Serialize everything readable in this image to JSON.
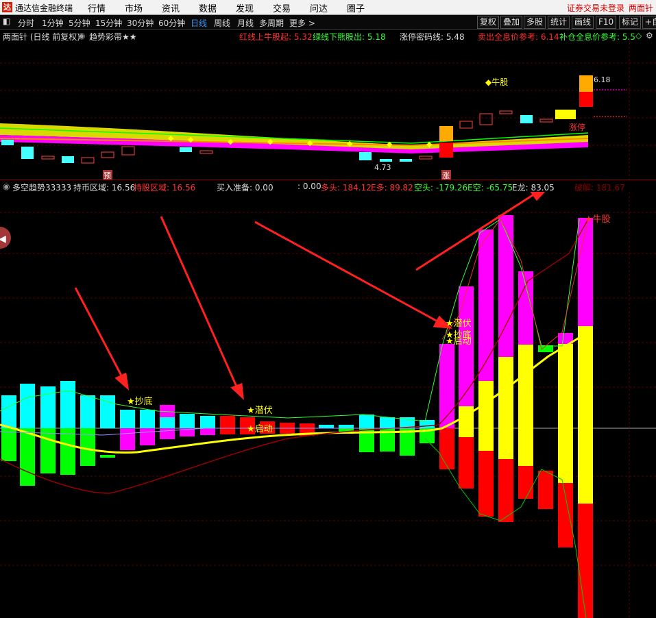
{
  "app": {
    "title": "通达信金融终端",
    "login_status": "证券交易未登录",
    "username": "两面针"
  },
  "menu": [
    "行情",
    "市场",
    "资讯",
    "数据",
    "发现",
    "交易",
    "问达",
    "圈子"
  ],
  "periods": [
    "分时",
    "1分钟",
    "5分钟",
    "15分钟",
    "30分钟",
    "60分钟",
    "日线",
    "周线",
    "月线",
    "多周期",
    "更多 >"
  ],
  "active_period": "日线",
  "right_tools": [
    "复权",
    "叠加",
    "多股",
    "统计",
    "画线",
    "F10",
    "标记",
    "+自"
  ],
  "top_panel": {
    "title": "两面针 (日线 前复权)",
    "indicator_name": "趋势彩带★★",
    "red_line_label": "红线上牛股起: 5.32",
    "green_line_label": "绿线下熊股出: 5.18",
    "limit_label": "涨停密码线: 5.48",
    "sell_label": "卖出全息价参考: 6.14",
    "buy_label": "补仓全息价参考: 5.5",
    "high_price": "6.18",
    "low_price": "4.73",
    "bull_label": "◆牛股",
    "limit_up_label": "涨停",
    "marker_pre": "预",
    "marker_up": "涨"
  },
  "bottom_panel": {
    "title": "多空趋势33333",
    "hold_coin": "持币区域: 16.56",
    "hold_stock": "持股区域: 16.56",
    "buy_ready": "买入准备: 0.00",
    "colon_val": ": 0.00",
    "bulls": "多头: 184.12",
    "e_bull": "E多: 89.82",
    "bears": "空头: -179.26",
    "e_bear": "E空: -65.75",
    "e_dragon": "E龙: 83.05",
    "break": "破解: 181.67",
    "signals": {
      "bottom": "★抄底",
      "lurk": "★潜伏",
      "start": "★启动",
      "bull": "★牛股"
    }
  },
  "colors": {
    "red": "#ff0000",
    "green": "#00ff00",
    "cyan": "#00ffff",
    "magenta": "#ff00ff",
    "yellow": "#ffff00",
    "bg": "#000000"
  }
}
